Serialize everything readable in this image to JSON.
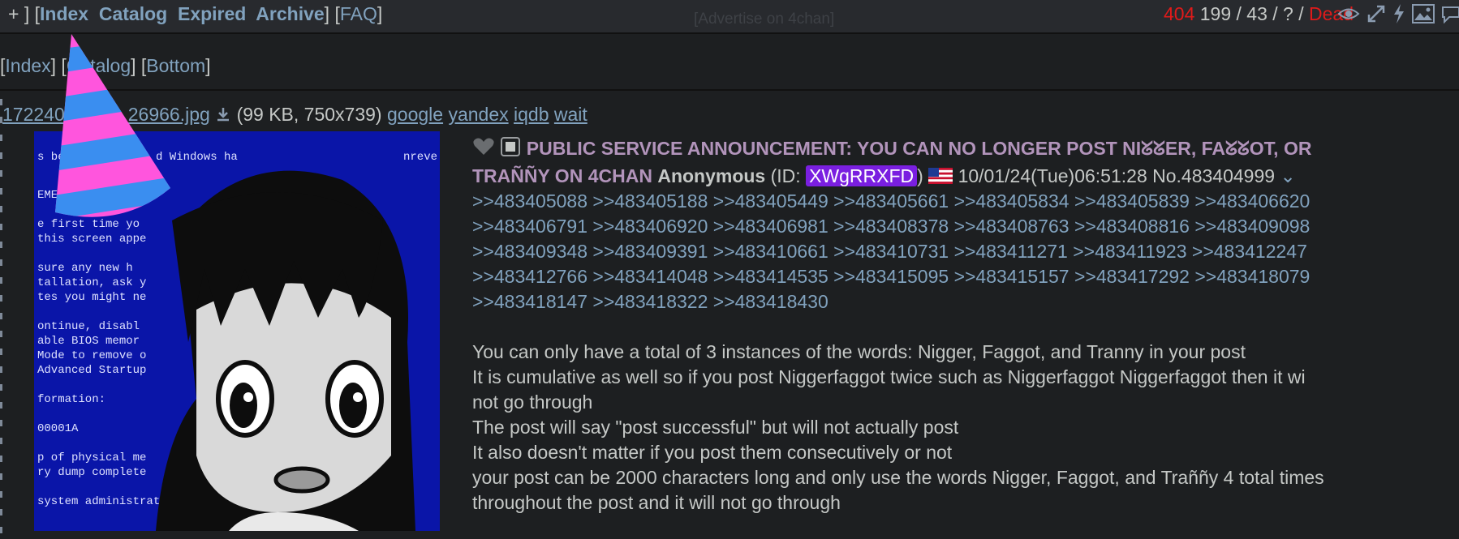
{
  "topbar": {
    "nav_prefix": "+ ] [",
    "nav_links": [
      "Index",
      "Catalog",
      "Expired",
      "Archive"
    ],
    "nav_mid": "] [",
    "faq": "FAQ",
    "nav_suffix": "]",
    "advert": "[Advertise on 4chan]",
    "stat_404": "404",
    "stat_counts": "199 / 43 / ? /",
    "stat_dead": "Dead"
  },
  "subnav": {
    "open1": "[",
    "index": "Index",
    "mid": "] [",
    "catalog": "Catalog",
    "mid2": "] [",
    "bottom": "Bottom",
    "close": "]"
  },
  "file": {
    "name_start": "172240",
    "name_end": "26966.jpg",
    "meta": "(99 KB, 750x739)",
    "search_links": [
      "google",
      "yandex",
      "iqdb",
      "wait"
    ]
  },
  "post": {
    "subject_line1": "PUBLIC SERVICE ANNOUNCEMENT: YOU CAN NO LONGER POST NIᘜᘜER, FAᘜᘜOT, OR",
    "subject_line2": "TRAÑÑY ON 4CHAN",
    "name": "Anonymous",
    "id_label_open": "(ID:",
    "id": "XWgRRXFD",
    "id_label_close": ")",
    "datetime": "10/01/24(Tue)06:51:28",
    "number": "No.483404999",
    "menu_glyph": "⌄",
    "replies": [
      ">>483405088",
      ">>483405188",
      ">>483405449",
      ">>483405661",
      ">>483405834",
      ">>483405839",
      ">>483406620",
      ">>483406791",
      ">>483406920",
      ">>483406981",
      ">>483408378",
      ">>483408763",
      ">>483408816",
      ">>483409098",
      ">>483409348",
      ">>483409391",
      ">>483410661",
      ">>483410731",
      ">>483411271",
      ">>483411923",
      ">>483412247",
      ">>483412766",
      ">>483414048",
      ">>483414535",
      ">>483415095",
      ">>483415157",
      ">>483417292",
      ">>483418079",
      ">>483418147",
      ">>483418322",
      ">>483418430"
    ],
    "body_lines": [
      "You can only have a total of 3 instances of the words: Nigger, Faggot, and Tranny in your post",
      "It is cumulative as well so if you post Niggerfaggot twice such as Niggerfaggot Niggerfaggot then it wi",
      "not go through",
      "The post will say \"post successful\" but will not actually post",
      "It also doesn't matter if you post them consecutively or not",
      "your post can be 2000 characters long and only use the words Nigger, Faggot, and Traññy 4 total times",
      "throughout the post and it will not go through"
    ]
  },
  "thumb_text_lines": [
    "s beg",
    "d Windows ha",
    "nreve",
    "EMEN",
    "e first time yo",
    "this screen appe",
    "sure any new h",
    "tallation, ask y",
    "tes you might ne",
    "ontinue, disabl",
    "able BIOS memor",
    "Mode to remove o",
    "Advanced Startup",
    "formation:",
    "00001A",
    "p of physical me",
    "ry dump complete",
    "system administrat"
  ],
  "colors": {
    "background": "#1d1f21",
    "link": "#81a2be",
    "subject": "#b294bb",
    "dead": "#e01a1a",
    "id_badge": "#7a1fe0"
  }
}
